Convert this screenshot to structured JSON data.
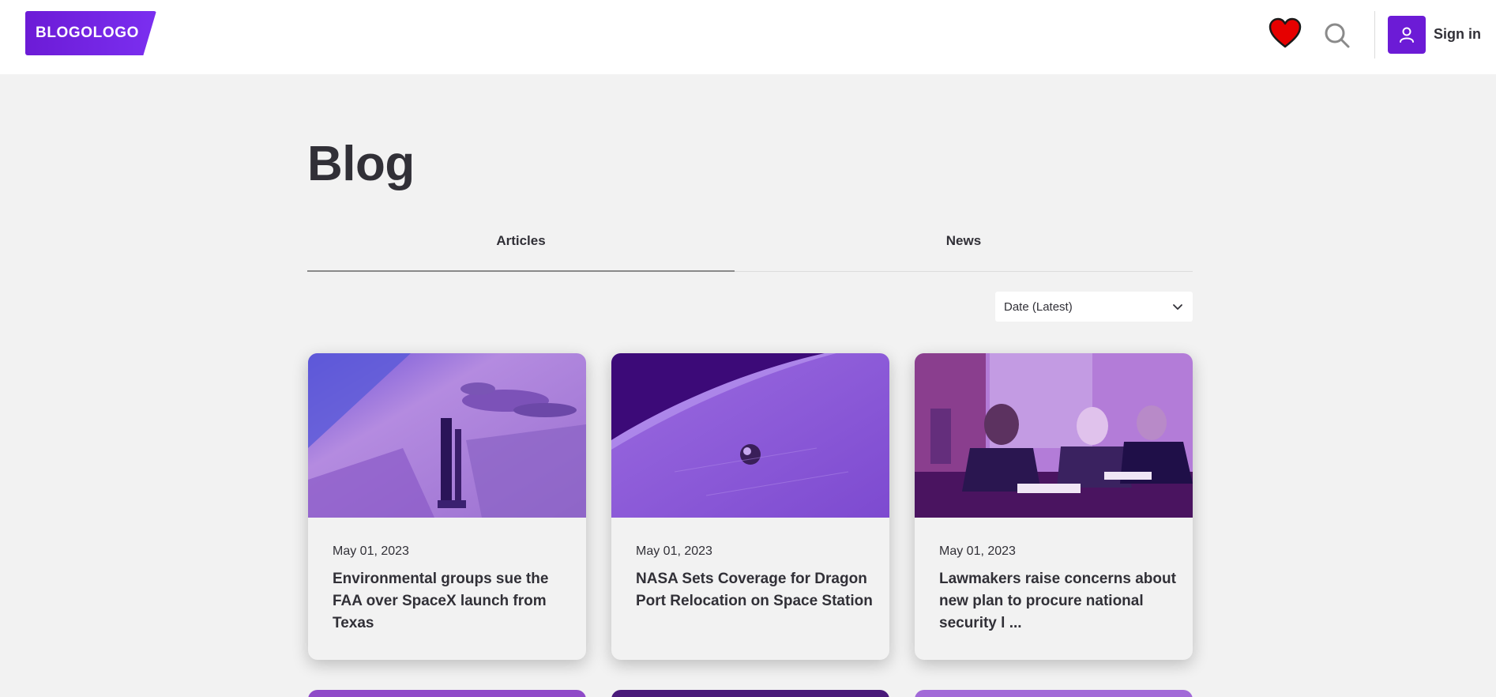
{
  "header": {
    "logo_text": "BLOGOLOGO",
    "favorites_icon": "heart-icon",
    "search_icon": "search-icon",
    "user_icon": "user-icon",
    "signin_label": "Sign in",
    "accent_color": "#6c1bd6",
    "heart_color": "#e60000"
  },
  "main": {
    "title": "Blog",
    "tabs": [
      {
        "label": "Articles",
        "active": true
      },
      {
        "label": "News",
        "active": false
      }
    ],
    "sort": {
      "selected": "Date (Latest)",
      "icon": "chevron-down-icon"
    },
    "cards": [
      {
        "date": "May 01, 2023",
        "title": "Environmental groups sue the FAA over SpaceX launch from Texas"
      },
      {
        "date": "May 01, 2023",
        "title": "NASA Sets Coverage for Dragon Port Relocation on Space Station"
      },
      {
        "date": "May 01, 2023",
        "title": "Lawmakers raise concerns about new plan to procure national security l ..."
      }
    ]
  }
}
